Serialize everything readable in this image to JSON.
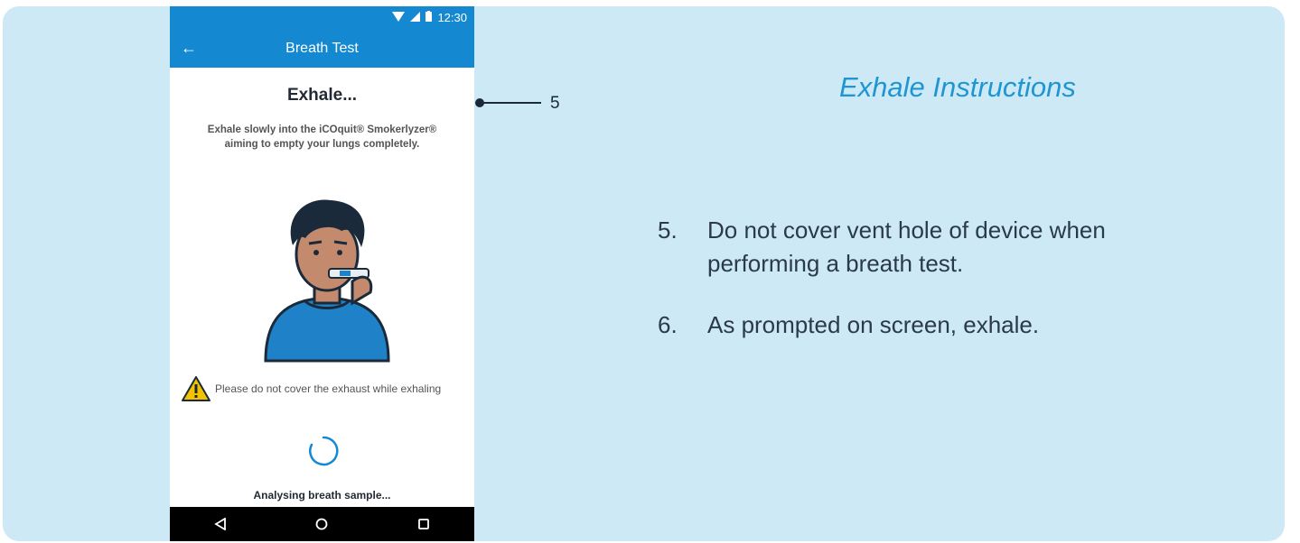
{
  "phone": {
    "status": {
      "time": "12:30"
    },
    "app_bar": {
      "title": "Breath Test"
    },
    "heading": "Exhale...",
    "description_line1": "Exhale slowly into the iCOquit® Smokerlyzer®",
    "description_line2": "aiming to empty your lungs completely.",
    "warning": "Please do not cover the exhaust while exhaling",
    "status_text": "Analysing breath sample..."
  },
  "callout": {
    "number": "5"
  },
  "instructions": {
    "title": "Exhale Instructions",
    "steps": [
      {
        "num": "5.",
        "line1": "Do not cover vent hole of device when",
        "line2": "performing a breath test."
      },
      {
        "num": "6.",
        "line1": "As prompted on screen, exhale.",
        "line2": ""
      }
    ]
  },
  "colors": {
    "accent": "#1489d2",
    "panel_bg": "#cde9f5",
    "title_color": "#1e96d2"
  }
}
